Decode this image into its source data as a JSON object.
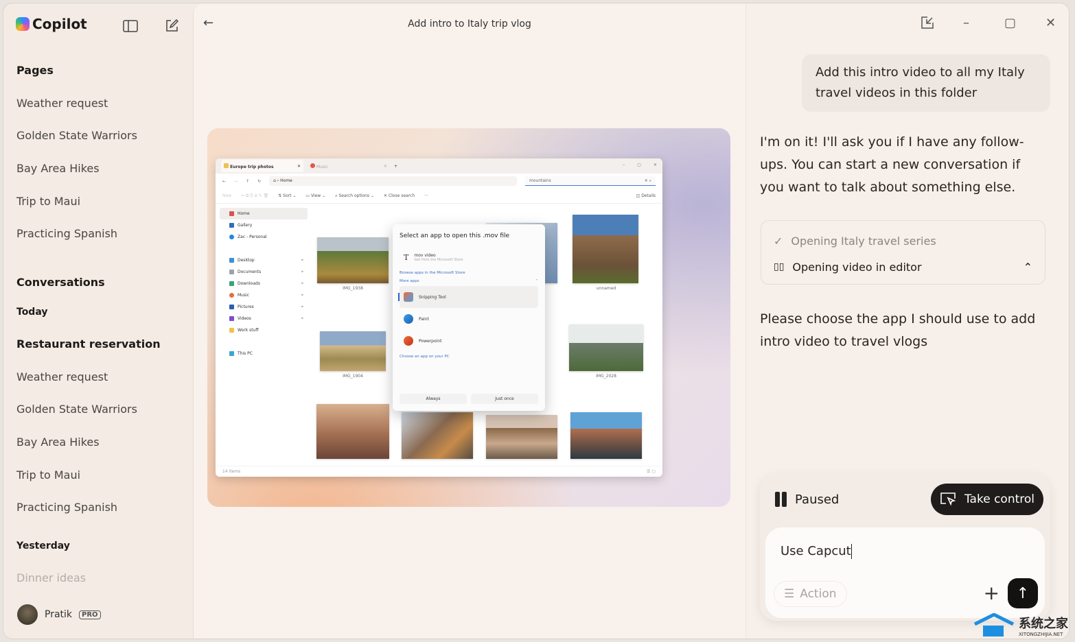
{
  "app": {
    "name": "Copilot"
  },
  "sidebar": {
    "pages_heading": "Pages",
    "pages": [
      "Weather request",
      "Golden State Warriors",
      "Bay Area Hikes",
      "Trip to Maui",
      "Practicing Spanish"
    ],
    "conversations_heading": "Conversations",
    "today_label": "Today",
    "today": [
      "Restaurant reservation",
      "Weather request",
      "Golden State Warriors",
      "Bay Area Hikes",
      "Trip to Maui",
      "Practicing Spanish"
    ],
    "yesterday_label": "Yesterday",
    "yesterday": [
      "Dinner ideas"
    ],
    "user": {
      "name": "Pratik",
      "badge": "PRO"
    }
  },
  "main": {
    "title": "Add intro to Italy trip vlog"
  },
  "explorer": {
    "tabs": [
      "Europe trip photos",
      "Music"
    ],
    "address": "Home",
    "search": "mountains",
    "toolbar": [
      "New",
      "Sort",
      "View",
      "Search options",
      "Close search",
      "Details"
    ],
    "nav": [
      "Home",
      "Gallery",
      "Zac - Personal",
      "Desktop",
      "Documents",
      "Downloads",
      "Music",
      "Pictures",
      "Videos",
      "Work stuff",
      "This PC"
    ],
    "captions": [
      "IMG_1938",
      "unnamed",
      "IMG_1904",
      "IMG_2028"
    ],
    "status": "14 items",
    "dialog": {
      "title": "Select an app to open this .mov file",
      "store_app": "mov video",
      "store_sub": "Get from the Microsoft Store",
      "browse": "Browse apps in the Microsoft Store",
      "more": "More apps",
      "apps": [
        "Snipping Tool",
        "Paint",
        "Powerpoint"
      ],
      "choose": "Choose an app on your PC",
      "always": "Always",
      "once": "Just once"
    }
  },
  "chat": {
    "user_message": "Add this intro video to all my Italy travel videos in this folder",
    "reply1": "I'm on it! I'll ask you if I have any follow-ups. You can start a new conversation if you want to talk about something else.",
    "steps": [
      "Opening Italy travel series",
      "Opening video in editor"
    ],
    "reply2": "Please choose the app I should use to add intro video to travel vlogs",
    "status": "Paused",
    "take_control": "Take control",
    "input_value": "Use Capcut",
    "action_label": "Action"
  },
  "watermark": {
    "cn": "系统之家",
    "url": "XITONGZHIJIA.NET"
  }
}
